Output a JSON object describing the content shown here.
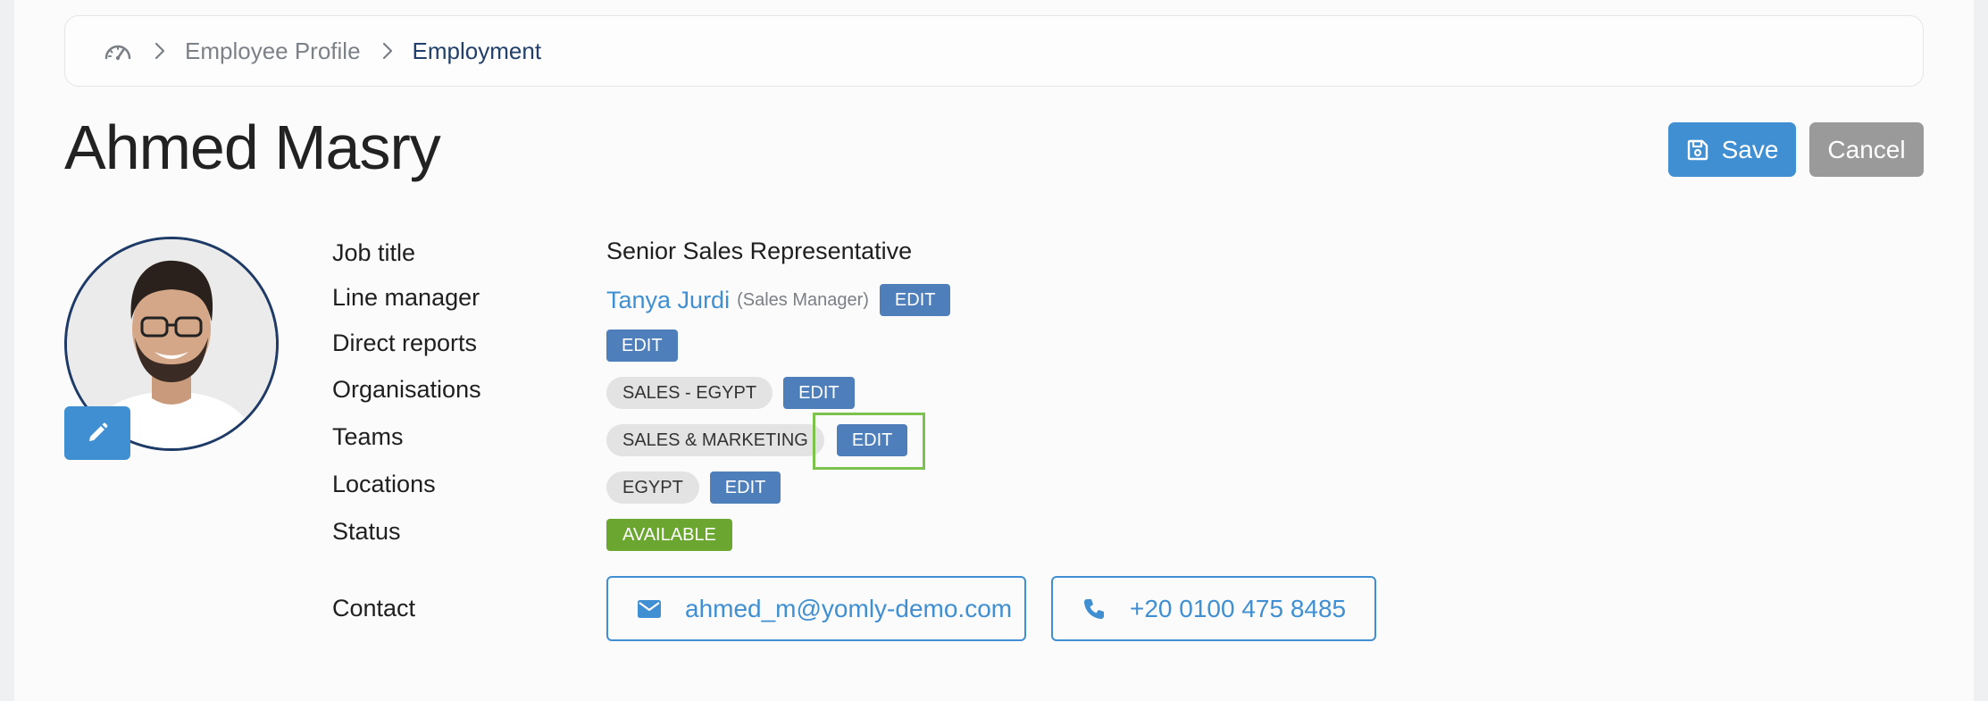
{
  "breadcrumb": {
    "home_icon": "speedometer-icon",
    "items": [
      "Employee Profile",
      "Employment"
    ]
  },
  "header": {
    "name": "Ahmed Masry",
    "save_label": "Save",
    "cancel_label": "Cancel"
  },
  "profile": {
    "labels": {
      "job_title": "Job title",
      "line_manager": "Line manager",
      "direct_reports": "Direct reports",
      "organisations": "Organisations",
      "teams": "Teams",
      "locations": "Locations",
      "status": "Status",
      "contact": "Contact"
    },
    "job_title": "Senior Sales Representative",
    "line_manager": {
      "name": "Tanya Jurdi",
      "role": "(Sales Manager)"
    },
    "organisations": [
      "SALES - EGYPT"
    ],
    "teams": [
      "SALES & MARKETING"
    ],
    "locations": [
      "EGYPT"
    ],
    "status": "AVAILABLE",
    "email": "ahmed_m@yomly-demo.com",
    "phone": "+20 0100 475 8485",
    "edit_label": "EDIT"
  },
  "colors": {
    "accent": "#3f8fd2",
    "edit_button": "#4f7fba",
    "status_available": "#6aa630",
    "highlight": "#7cc34e",
    "cancel": "#9a9a9a"
  }
}
